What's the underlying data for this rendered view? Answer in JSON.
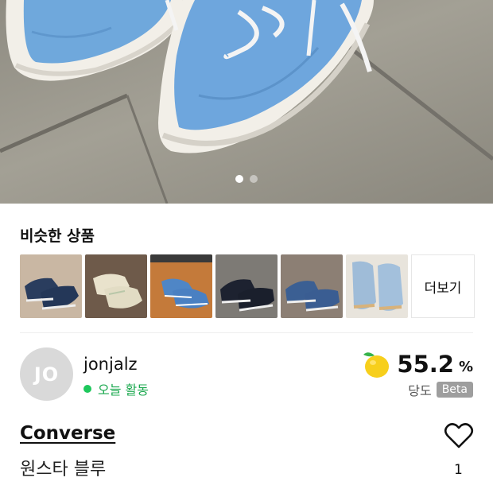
{
  "hero": {
    "image": "blue-suede-sneakers-photo",
    "carousel": {
      "total": 2,
      "active": 1
    }
  },
  "similar": {
    "title": "비슷한 상품",
    "thumbnails": [
      "navy-sneakers-photo",
      "cream-sneakers-photo",
      "blue-sneakers-photo",
      "black-sneakers-photo",
      "denim-sneakers-photo",
      "lightblue-sneakers-photo"
    ],
    "more_label": "더보기"
  },
  "seller": {
    "initials": "JO",
    "name": "jonjalz",
    "activity": "오늘 활동",
    "activity_color": "#1ec85c"
  },
  "sweetness": {
    "score": "55.2",
    "unit": "%",
    "label": "당도",
    "badge": "Beta",
    "icon": "lemon-icon"
  },
  "product": {
    "brand": "Converse",
    "name": "원스타 블루",
    "like_icon": "heart-icon",
    "likes": "1"
  }
}
